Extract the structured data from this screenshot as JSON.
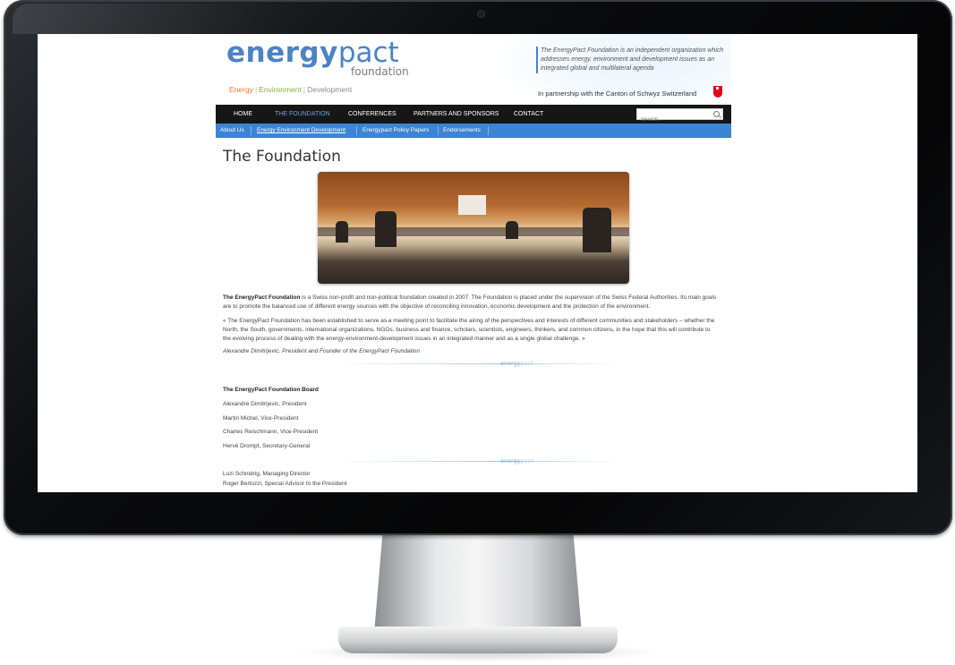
{
  "header": {
    "logo_energy": "energy",
    "logo_pact": "pact",
    "logo_foundation": "foundation",
    "tagline": [
      "Energy",
      "Environment",
      "Development"
    ],
    "tagline_sep": "|",
    "description": "The EnergyPact Foundation is an independent organization which addresses energy, environment and development issues as an integrated global and multilateral agenda",
    "partnership": "In partnership with the Canton of Schwyz Switzerland"
  },
  "nav": {
    "items": [
      "HOME",
      "THE FOUNDATION",
      "CONFERENCES",
      "PARTNERS AND SPONSORS",
      "CONTACT"
    ],
    "active": "THE FOUNDATION",
    "search_placeholder": "Search..."
  },
  "subnav": {
    "items": [
      "About Us",
      "Energy Environment Development",
      "Energypact Policy Papers",
      "Endorsements"
    ],
    "active": "Energy Environment Development"
  },
  "content": {
    "title": "The Foundation",
    "intro_bold": "The EnergyPact Foundation",
    "intro_rest": " is a Swiss non-profit and non-political foundation created in 2007. The Foundation is placed under the supervision of the Swiss Federal Authorities. Its main goals are to promote the balanced use of different energy sources with the objective of reconciling innovation, economic development and the protection of the environment.",
    "quote": "« The EnergyPact Foundation has been established to serve as a meeting point to facilitate the airing of the perspectives and interests of different communities and stakeholders – whether the North, the South, governments, international organizations, NGOs, business and finance, scholars, scientists, engineers, thinkers, and common citizens, in the hope that this will contribute to the evolving process of dealing with the energy-environment-development issues in an integrated manner and as a single global challenge. »",
    "quote_author": "Alexandre Dimitrijevic, President and Founder of the EnergyPact Foundation",
    "divider_logo_a": "energy",
    "divider_logo_b": "pact",
    "board_title": "The EnergyPact Foundation Board",
    "board": [
      "Alexandre Dimitrijevic, President",
      "Martin Michel, Vice-President",
      "Charles Reischmann, Vice-President",
      "Hervé Drompt, Secretary-General"
    ],
    "staff": [
      "Luzi Schnidrig, Managing Director",
      "Roger Bertozzi, Special Advisor to the President"
    ]
  },
  "colors": {
    "brand_blue": "#4c83c4",
    "nav_bg": "#161616",
    "subnav_bg": "#3c84d4",
    "tag_energy": "#e67a2b",
    "tag_environment": "#89b42f"
  },
  "icons": {
    "search": "search-icon",
    "crest": "schwyz-crest-icon"
  }
}
